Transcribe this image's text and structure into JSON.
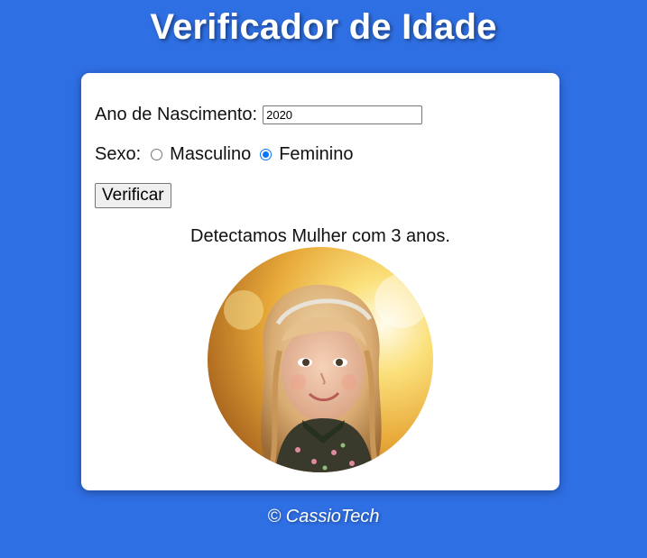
{
  "page": {
    "title": "Verificador de Idade",
    "footer": "© CassioTech"
  },
  "form": {
    "year_label": "Ano de Nascimento:",
    "year_value": "2020",
    "sex_label": "Sexo:",
    "options": [
      {
        "label": "Masculino",
        "checked": false
      },
      {
        "label": "Feminino",
        "checked": true
      }
    ],
    "button_label": "Verificar"
  },
  "result": {
    "text": "Detectamos Mulher com 3 anos."
  },
  "colors": {
    "background": "#2f6fe4",
    "card": "#ffffff",
    "radio_checked": "#0075ff"
  }
}
